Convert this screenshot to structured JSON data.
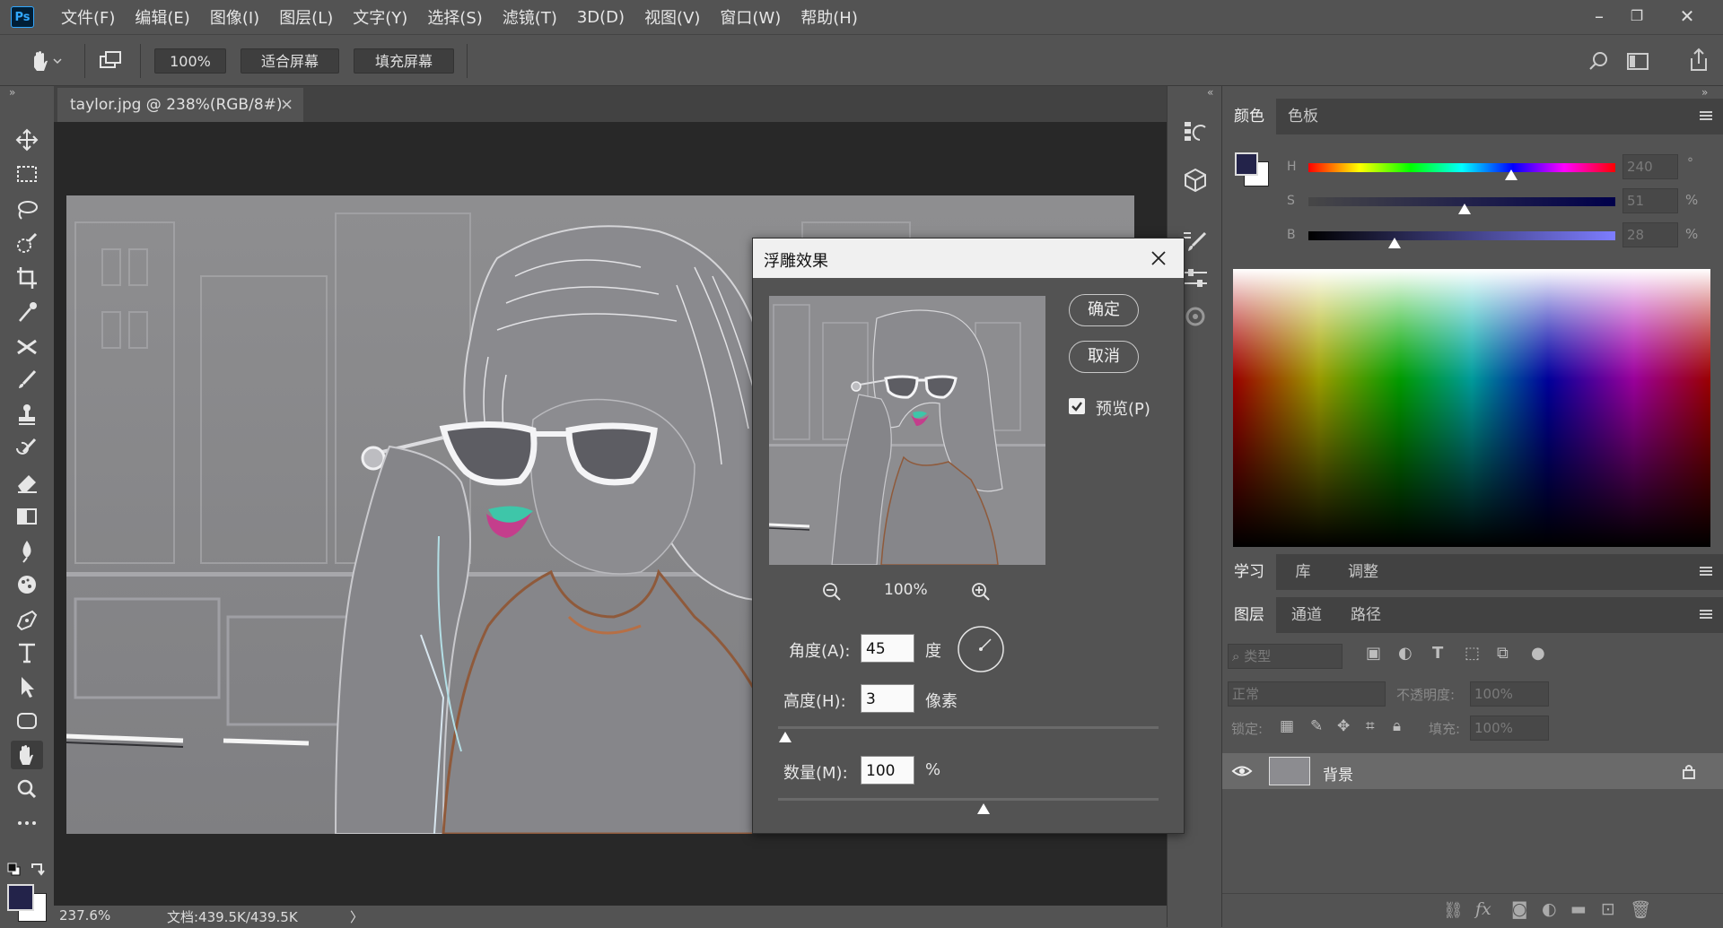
{
  "app": {
    "logo": "Ps"
  },
  "menu": [
    "文件(F)",
    "编辑(E)",
    "图像(I)",
    "图层(L)",
    "文字(Y)",
    "选择(S)",
    "滤镜(T)",
    "3D(D)",
    "视图(V)",
    "窗口(W)",
    "帮助(H)"
  ],
  "window_controls": {
    "minimize": "–",
    "restore": "❐",
    "close": "✕"
  },
  "options": {
    "zoom": "100%",
    "fit_screen": "适合屏幕",
    "fill_screen": "填充屏幕"
  },
  "document": {
    "tab_title": "taylor.jpg @ 238%(RGB/8#)",
    "tab_close": "×"
  },
  "status": {
    "zoom": "237.6%",
    "doc_info": "文档:439.5K/439.5K",
    "arrow": "〉"
  },
  "color_panel": {
    "tabs": [
      "颜色",
      "色板"
    ],
    "h_label": "H",
    "s_label": "S",
    "b_label": "B",
    "h_value": "240",
    "s_value": "51",
    "b_value": "28",
    "h_unit": "°",
    "s_unit": "%",
    "b_unit": "%",
    "h_level": 0.66,
    "s_level": 0.51,
    "b_level": 0.28,
    "foreground_color": "#23234a",
    "background_color": "#ffffff"
  },
  "learn_panel": {
    "tabs": [
      "学习",
      "库",
      "调整"
    ]
  },
  "layers_panel": {
    "tabs": [
      "图层",
      "通道",
      "路径"
    ],
    "filter_placeholder": "类型",
    "blend_mode": "正常",
    "opacity_label": "不透明度:",
    "opacity_value": "100%",
    "lock_label": "锁定:",
    "fill_label": "填充:",
    "fill_value": "100%",
    "layers": [
      {
        "name": "背景",
        "visible": true,
        "locked": true
      }
    ]
  },
  "dialog": {
    "title": "浮雕效果",
    "ok": "确定",
    "cancel": "取消",
    "preview_label": "预览(P)",
    "preview_checked": true,
    "preview_zoom": "100%",
    "angle_label": "角度(A):",
    "angle_value": "45",
    "angle_unit": "度",
    "height_label": "高度(H):",
    "height_value": "3",
    "height_unit": "像素",
    "height_level": 0.02,
    "amount_label": "数量(M):",
    "amount_value": "100",
    "amount_unit": "%",
    "amount_level": 0.54
  }
}
